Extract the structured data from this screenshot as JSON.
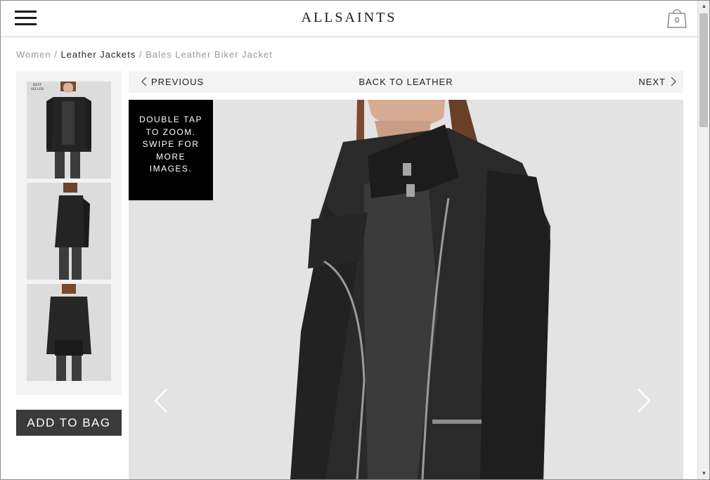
{
  "header": {
    "logo": "ALLSAINTS",
    "bag_count": "0",
    "menu_icon": "hamburger-icon",
    "bag_icon": "shopping-bag-icon"
  },
  "breadcrumb": {
    "items": [
      "Women",
      "Leather Jackets",
      "Bales Leather Biker Jacket"
    ],
    "separator": "/"
  },
  "product_nav": {
    "previous": "PREVIOUS",
    "back": "BACK TO LEATHER",
    "next": "NEXT"
  },
  "thumbnails": {
    "badge": "BEST SELLER"
  },
  "gallery": {
    "overlay_text": "DOUBLE TAP TO ZOOM. SWIPE FOR MORE IMAGES."
  },
  "actions": {
    "add_to_bag": "ADD TO BAG"
  },
  "colors": {
    "button_bg": "#3a3a3a",
    "overlay_bg": "#000000",
    "panel_bg": "#f3f3f3"
  }
}
